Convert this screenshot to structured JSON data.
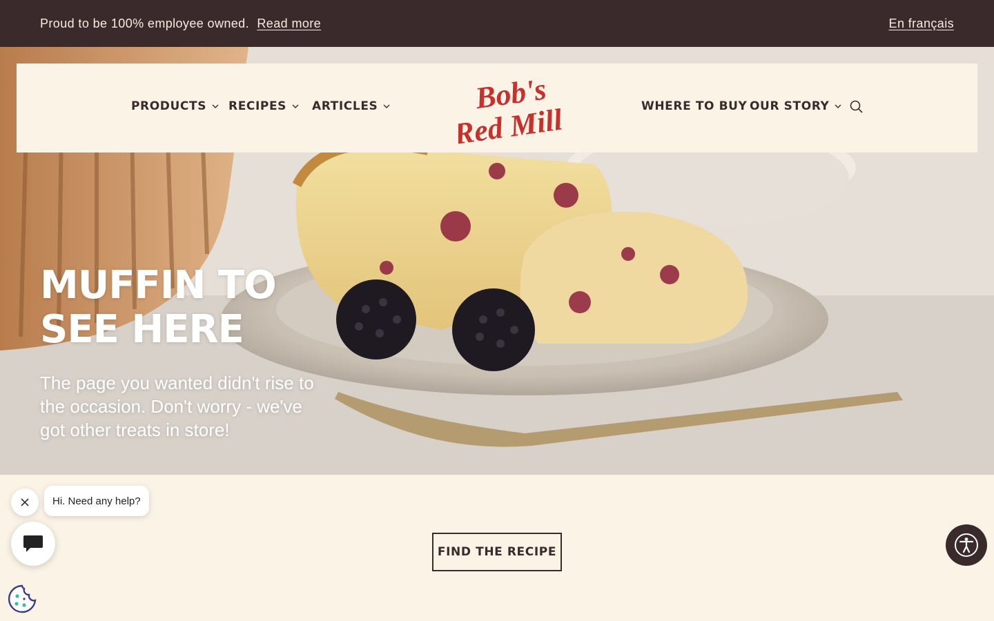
{
  "announcement": {
    "text": "Proud to be 100% employee owned.",
    "link": "Read more",
    "language_link": "En français"
  },
  "nav": {
    "products": "PRODUCTS",
    "recipes": "RECIPES",
    "articles": "ARTICLES",
    "where_to_buy": "WHERE TO BUY",
    "our_story": "OUR STORY",
    "logo_text_line1": "Bob's",
    "logo_text_line2": "Red Mill"
  },
  "hero": {
    "title": "MUFFIN TO SEE HERE",
    "subtitle": "The page you wanted didn't rise to the occasion. Don't worry - we've got other treats in store!"
  },
  "cta": {
    "label": "FIND THE RECIPE"
  },
  "chat": {
    "greeting": "Hi. Need any help?"
  },
  "colors": {
    "brand_dark": "#3b2a2c",
    "brand_red": "#c8302c",
    "cream": "#faf3e6"
  },
  "icons": [
    "chevron-down-icon",
    "search-icon",
    "close-icon",
    "chat-icon",
    "cookie-icon",
    "accessibility-icon"
  ]
}
